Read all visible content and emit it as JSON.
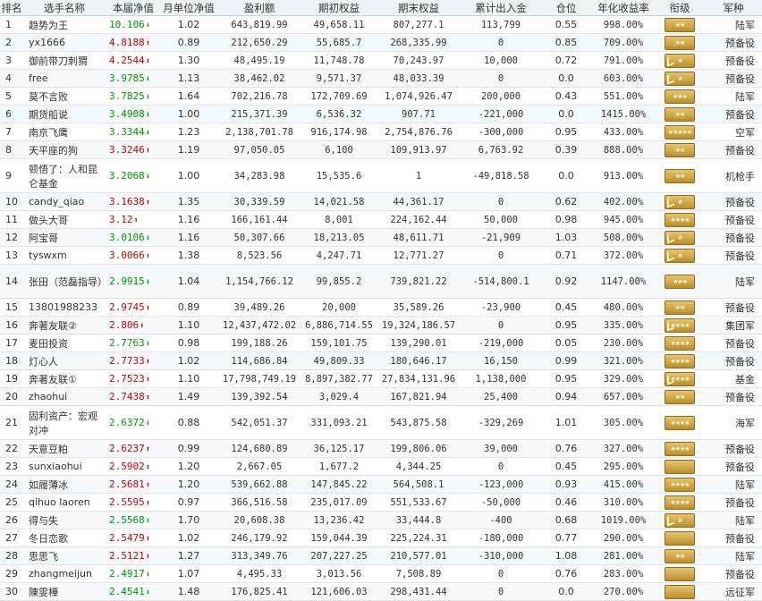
{
  "headers": [
    "排名",
    "选手名称",
    "本届净值",
    "月单位净值",
    "盈利额",
    "期初权益",
    "期末权益",
    "累计出入金",
    "仓位",
    "年化收益率",
    "衔级",
    "军种"
  ],
  "rows": [
    {
      "rank": "1",
      "name": "趋势为王",
      "nav": "10.106",
      "dir": "down",
      "unit": "1.02",
      "profit": "643,819.99",
      "begin": "49,658.11",
      "end": "807,277.1",
      "flow": "113,799",
      "pos": "0.55",
      "annual": "998.00%",
      "insignia": "two-star",
      "arm": "陆军"
    },
    {
      "rank": "2",
      "name": "yx1666",
      "nav": "4.8188",
      "dir": "up",
      "unit": "0.89",
      "profit": "212,650.29",
      "begin": "55,685.7",
      "end": "268,335.99",
      "flow": "0",
      "pos": "0.85",
      "annual": "709.00%",
      "insignia": "two-star",
      "arm": "预备役"
    },
    {
      "rank": "3",
      "name": "御前带刀刺猬",
      "nav": "4.2544",
      "dir": "up",
      "unit": "1.30",
      "profit": "48,495.19",
      "begin": "11,748.78",
      "end": "70,243.97",
      "flow": "10,000",
      "pos": "0.72",
      "annual": "791.00%",
      "insignia": "chevron-star",
      "arm": "预备役"
    },
    {
      "rank": "4",
      "name": "free",
      "nav": "3.9785",
      "dir": "down",
      "unit": "1.13",
      "profit": "38,462.02",
      "begin": "9,571.37",
      "end": "48,033.39",
      "flow": "0",
      "pos": "0.0",
      "annual": "603.00%",
      "insignia": "chevron-star",
      "arm": "预备役"
    },
    {
      "rank": "5",
      "name": "莫不言败",
      "nav": "3.7825",
      "dir": "down",
      "unit": "1.64",
      "profit": "702,216.78",
      "begin": "172,709.69",
      "end": "1,074,926.47",
      "flow": "200,000",
      "pos": "0.43",
      "annual": "551.00%",
      "insignia": "three-star",
      "arm": "陆军"
    },
    {
      "rank": "6",
      "name": "期货船说",
      "nav": "3.4908",
      "dir": "down",
      "unit": "1.00",
      "profit": "215,371.39",
      "begin": "6,536.32",
      "end": "907.71",
      "flow": "-221,000",
      "pos": "0.0",
      "annual": "1415.00%",
      "insignia": "two-star",
      "arm": "预备役"
    },
    {
      "rank": "7",
      "name": "南京飞鹰",
      "nav": "3.3344",
      "dir": "down",
      "unit": "1.23",
      "profit": "2,138,701.78",
      "begin": "916,174.98",
      "end": "2,754,876.76",
      "flow": "-300,000",
      "pos": "0.95",
      "annual": "433.00%",
      "insignia": "five-star",
      "arm": "空军"
    },
    {
      "rank": "8",
      "name": "天平座的狗",
      "nav": "3.3246",
      "dir": "up",
      "unit": "1.19",
      "profit": "97,050.05",
      "begin": "6,100",
      "end": "109,913.97",
      "flow": "6,763.92",
      "pos": "0.39",
      "annual": "888.00%",
      "insignia": "two-star",
      "arm": "预备役"
    },
    {
      "rank": "9",
      "name": "顿悟了：人和昆仑基金",
      "nav": "3.2068",
      "dir": "down",
      "unit": "1.00",
      "profit": "34,283.98",
      "begin": "15,535.6",
      "end": "1",
      "flow": "-49,818.58",
      "pos": "0.0",
      "annual": "913.00%",
      "insignia": "two-star",
      "arm": "机枪手",
      "tall": true
    },
    {
      "rank": "10",
      "name": "candy_qiao",
      "nav": "3.1638",
      "dir": "up",
      "unit": "1.35",
      "profit": "30,339.59",
      "begin": "14,021.58",
      "end": "44,361.17",
      "flow": "0",
      "pos": "0.62",
      "annual": "402.00%",
      "insignia": "chevron-star",
      "arm": "预备役"
    },
    {
      "rank": "11",
      "name": "做头大哥",
      "nav": "3.12",
      "dir": "up",
      "unit": "1.16",
      "profit": "166,161.44",
      "begin": "8,001",
      "end": "224,162.44",
      "flow": "50,000",
      "pos": "0.98",
      "annual": "945.00%",
      "insignia": "four-star",
      "arm": "预备役"
    },
    {
      "rank": "12",
      "name": "阿宝哥",
      "nav": "3.0106",
      "dir": "down",
      "unit": "1.16",
      "profit": "50,307.66",
      "begin": "18,213.05",
      "end": "48,611.71",
      "flow": "-21,909",
      "pos": "1.03",
      "annual": "508.00%",
      "insignia": "chevron-star",
      "arm": "预备役"
    },
    {
      "rank": "13",
      "name": "tyswxm",
      "nav": "3.0066",
      "dir": "up",
      "unit": "1.38",
      "profit": "8,523.56",
      "begin": "4,247.71",
      "end": "12,771.27",
      "flow": "0",
      "pos": "0.71",
      "annual": "372.00%",
      "insignia": "chevron-star",
      "arm": "预备役"
    },
    {
      "rank": "14",
      "name": "张田（范磊指导）",
      "nav": "2.9915",
      "dir": "down",
      "unit": "1.04",
      "profit": "1,154,766.12",
      "begin": "99,855.2",
      "end": "739,821.22",
      "flow": "-514,800.1",
      "pos": "0.92",
      "annual": "1147.00%",
      "insignia": "three-star",
      "arm": "陆军",
      "tall": true
    },
    {
      "rank": "15",
      "name": "13801988233",
      "nav": "2.9745",
      "dir": "up",
      "unit": "0.89",
      "profit": "39,489.26",
      "begin": "20,000",
      "end": "35,589.26",
      "flow": "-23,900",
      "pos": "0.45",
      "annual": "480.00%",
      "insignia": "two-star",
      "arm": "预备役"
    },
    {
      "rank": "16",
      "name": "奔著友联②",
      "nav": "2.806",
      "dir": "up",
      "unit": "1.10",
      "profit": "12,437,472.02",
      "begin": "6,886,714.55",
      "end": "19,324,186.57",
      "flow": "0",
      "pos": "0.95",
      "annual": "335.00%",
      "insignia": "chevron-four-star",
      "arm": "集团军"
    },
    {
      "rank": "17",
      "name": "麦田投资",
      "nav": "2.7763",
      "dir": "down",
      "unit": "0.98",
      "profit": "199,188.26",
      "begin": "159,101.75",
      "end": "139,290.01",
      "flow": "-219,000",
      "pos": "0.05",
      "annual": "230.00%",
      "insignia": "four-star",
      "arm": "预备役"
    },
    {
      "rank": "18",
      "name": "灯心人",
      "nav": "2.7733",
      "dir": "up",
      "unit": "1.02",
      "profit": "114,686.84",
      "begin": "49,809.33",
      "end": "180,646.17",
      "flow": "16,150",
      "pos": "0.99",
      "annual": "321.00%",
      "insignia": "four-star",
      "arm": "预备役"
    },
    {
      "rank": "19",
      "name": "奔著友联①",
      "nav": "2.7523",
      "dir": "up",
      "unit": "1.10",
      "profit": "17,798,749.19",
      "begin": "8,897,382.77",
      "end": "27,834,131.96",
      "flow": "1,138,000",
      "pos": "0.95",
      "annual": "329.00%",
      "insignia": "chevron-four-star",
      "arm": "基金"
    },
    {
      "rank": "20",
      "name": "zhaohui",
      "nav": "2.7438",
      "dir": "up",
      "unit": "1.49",
      "profit": "139,392.54",
      "begin": "3,029.4",
      "end": "167,821.94",
      "flow": "25,400",
      "pos": "0.94",
      "annual": "657.00%",
      "insignia": "two-star",
      "arm": "预备役"
    },
    {
      "rank": "21",
      "name": "固利资产：宏观对冲",
      "nav": "2.6372",
      "dir": "down",
      "unit": "0.88",
      "profit": "542,051.37",
      "begin": "331,093.21",
      "end": "543,875.58",
      "flow": "-329,269",
      "pos": "1.01",
      "annual": "305.00%",
      "insignia": "four-star",
      "arm": "海军",
      "tall": true
    },
    {
      "rank": "22",
      "name": "天意豆粕",
      "nav": "2.6237",
      "dir": "up",
      "unit": "0.99",
      "profit": "124,680.89",
      "begin": "36,125.17",
      "end": "199,806.06",
      "flow": "39,000",
      "pos": "0.76",
      "annual": "327.00%",
      "insignia": "four-star",
      "arm": "预备役"
    },
    {
      "rank": "23",
      "name": "sunxiaohui",
      "nav": "2.5902",
      "dir": "up",
      "unit": "1.20",
      "profit": "2,667.05",
      "begin": "1,677.2",
      "end": "4,344.25",
      "flow": "0",
      "pos": "0.45",
      "annual": "295.00%",
      "insignia": "plain",
      "arm": "预备役"
    },
    {
      "rank": "24",
      "name": "如履薄冰",
      "nav": "2.5681",
      "dir": "up",
      "unit": "1.20",
      "profit": "539,662.88",
      "begin": "147,845.22",
      "end": "564,508.1",
      "flow": "-123,000",
      "pos": "0.93",
      "annual": "415.00%",
      "insignia": "four-star",
      "arm": "陆军"
    },
    {
      "rank": "25",
      "name": "qihuo laoren",
      "nav": "2.5595",
      "dir": "up",
      "unit": "0.97",
      "profit": "366,516.58",
      "begin": "235,017.09",
      "end": "551,533.67",
      "flow": "-50,000",
      "pos": "0.46",
      "annual": "310.00%",
      "insignia": "four-star",
      "arm": "预备役"
    },
    {
      "rank": "26",
      "name": "得与失",
      "nav": "2.5568",
      "dir": "down",
      "unit": "1.70",
      "profit": "20,608.38",
      "begin": "13,236.42",
      "end": "33,444.8",
      "flow": "-400",
      "pos": "0.68",
      "annual": "1019.00%",
      "insignia": "chevron-star",
      "arm": "陆军"
    },
    {
      "rank": "27",
      "name": "冬日恋歌",
      "nav": "2.5479",
      "dir": "up",
      "unit": "1.02",
      "profit": "246,179.92",
      "begin": "159,044.39",
      "end": "225,224.31",
      "flow": "-180,000",
      "pos": "0.77",
      "annual": "290.00%",
      "insignia": "plain",
      "arm": "预备役"
    },
    {
      "rank": "28",
      "name": "思思飞",
      "nav": "2.5121",
      "dir": "up",
      "unit": "1.27",
      "profit": "313,349.76",
      "begin": "207,227.25",
      "end": "210,577.01",
      "flow": "-310,000",
      "pos": "1.08",
      "annual": "281.00%",
      "insignia": "two-star",
      "arm": "陆军"
    },
    {
      "rank": "29",
      "name": "zhangmeijun",
      "nav": "2.4917",
      "dir": "down",
      "unit": "1.07",
      "profit": "4,495.33",
      "begin": "3,013.56",
      "end": "7,508.89",
      "flow": "0",
      "pos": "0.76",
      "annual": "283.00%",
      "insignia": "plain",
      "arm": "预备役"
    },
    {
      "rank": "30",
      "name": "陳雯樺",
      "nav": "2.4541",
      "dir": "down",
      "unit": "1.48",
      "profit": "176,825.41",
      "begin": "121,606.03",
      "end": "298,431.44",
      "flow": "0",
      "pos": "0.0",
      "annual": "270.00%",
      "insignia": "plain",
      "arm": "远征军"
    }
  ]
}
